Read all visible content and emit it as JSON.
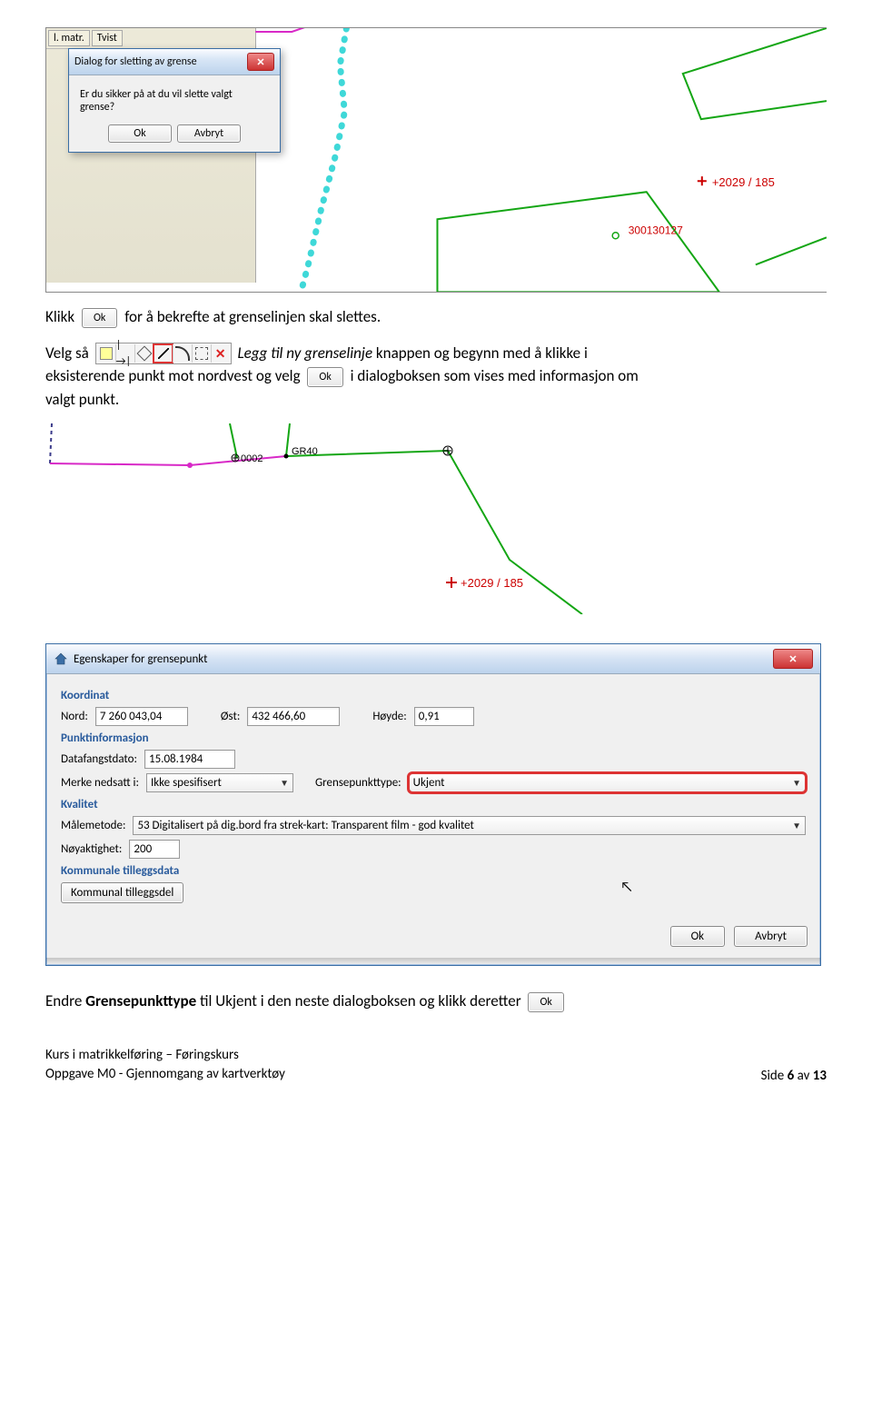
{
  "map_top": {
    "tabs": [
      "l. matr.",
      "Tvist"
    ],
    "dialog": {
      "title": "Dialog for sletting av grense",
      "message": "Er du sikker på at du vil slette valgt grense?",
      "ok": "Ok",
      "cancel": "Avbryt"
    },
    "label_coord": "+2029 / 185",
    "label_id": "300130127"
  },
  "para1": {
    "pre": "Klikk",
    "btn": "Ok",
    "post": "for å bekrefte at grenselinjen skal slettes."
  },
  "para2": {
    "pre": "Velg så",
    "mid_italic": "Legg til ny grenselinje",
    "mid_rest": " knappen og begynn med å klikke i",
    "line2_pre": "eksisterende punkt mot nordvest og velg",
    "btn": "Ok",
    "line2_post": "i dialogboksen som vises med informasjon om",
    "line3": "valgt punkt."
  },
  "map_mid": {
    "p1": "0002",
    "p2": "GR40",
    "coord": "+2029 / 185"
  },
  "prop": {
    "title": "Egenskaper for grensepunkt",
    "sections": {
      "koordinat": "Koordinat",
      "punkt": "Punktinformasjon",
      "kvalitet": "Kvalitet",
      "kommunal": "Kommunale tilleggsdata"
    },
    "labels": {
      "nord": "Nord:",
      "ost": "Øst:",
      "hoyde": "Høyde:",
      "datafangst": "Datafangstdato:",
      "merke": "Merke nedsatt i:",
      "grensepunkttype": "Grensepunkttype:",
      "malemetode": "Målemetode:",
      "noyaktighet": "Nøyaktighet:"
    },
    "values": {
      "nord": "7 260 043,04",
      "ost": "432 466,60",
      "hoyde": "0,91",
      "datafangst": "15.08.1984",
      "merke": "Ikke spesifisert",
      "grensepunkttype": "Ukjent",
      "malemetode": "53 Digitalisert på dig.bord fra strek-kart: Transparent film - god kvalitet",
      "noyaktighet": "200"
    },
    "buttons": {
      "kommunal": "Kommunal tilleggsdel",
      "ok": "Ok",
      "avbryt": "Avbryt"
    }
  },
  "para3": {
    "pre": "Endre ",
    "bold": "Grensepunkttype",
    "mid": " til ",
    "val": "Ukjent",
    "post": " i den neste dialogboksen og klikk deretter",
    "btn": "Ok"
  },
  "footer": {
    "line1": "Kurs i matrikkelføring – Føringskurs",
    "line2": "Oppgave M0 - Gjennomgang av kartverktøy",
    "right_pre": "Side ",
    "page": "6",
    "right_mid": " av ",
    "total": "13"
  }
}
